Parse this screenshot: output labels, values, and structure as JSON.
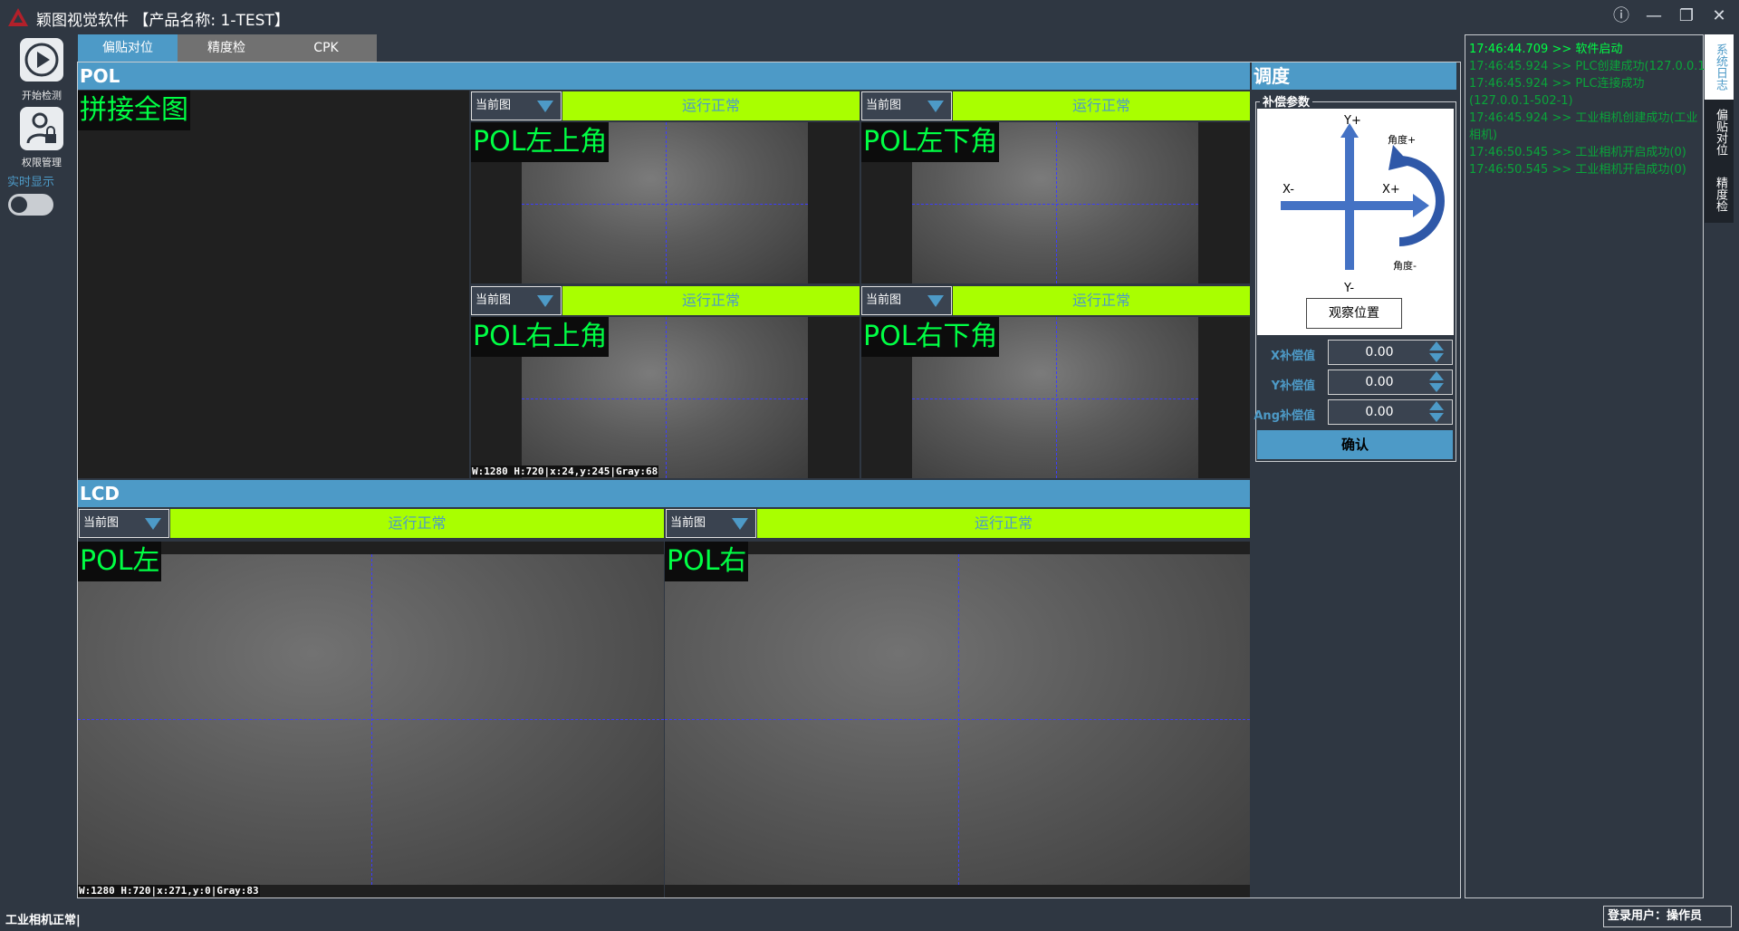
{
  "app": {
    "title": "颖图视觉软件",
    "product": "【产品名称: 1-TEST】"
  },
  "window_controls": [
    "info-icon",
    "minimize-icon",
    "restore-icon",
    "close-icon"
  ],
  "sidebar": {
    "start_label": "开始检测",
    "perm_label": "权限管理",
    "realtime_label": "实时显示",
    "realtime_on": false
  },
  "tabs": [
    {
      "label": "偏贴对位",
      "active": true
    },
    {
      "label": "精度检",
      "active": false
    },
    {
      "label": "CPK",
      "active": false
    }
  ],
  "pol": {
    "header": "POL",
    "stitch_label": "拼接全图",
    "cams": [
      {
        "label": "POL左上角",
        "select": "当前图",
        "status": "运行正常"
      },
      {
        "label": "POL左下角",
        "select": "当前图",
        "status": "运行正常"
      },
      {
        "label": "POL右上角",
        "select": "当前图",
        "status": "运行正常",
        "info": "W:1280 H:720|x:24,y:245|Gray:68"
      },
      {
        "label": "POL右下角",
        "select": "当前图",
        "status": "运行正常"
      }
    ]
  },
  "lcd": {
    "header": "LCD",
    "cams": [
      {
        "label": "POL左",
        "select": "当前图",
        "status": "运行正常",
        "info": "W:1280 H:720|x:271,y:0|Gray:83"
      },
      {
        "label": "POL右",
        "select": "当前图",
        "status": "运行正常"
      }
    ]
  },
  "adjust": {
    "header": "调度",
    "group": "补偿参数",
    "diagram": {
      "yplus": "Y+",
      "yminus": "Y-",
      "xminus": "X-",
      "xplus": "X+",
      "angplus": "角度+",
      "angminus": "角度-"
    },
    "observe_button": "观察位置",
    "fields": [
      {
        "label": "X补偿值",
        "value": "0.00"
      },
      {
        "label": "Y补偿值",
        "value": "0.00"
      },
      {
        "label": "Ang补偿值",
        "value": "0.00"
      }
    ],
    "confirm": "确认"
  },
  "log": {
    "lines": [
      {
        "text": "17:46:44.709 >> 软件启动",
        "dim": false
      },
      {
        "text": "17:46:45.924 >>  PLC创建成功(127.0.0.1)",
        "dim": true
      },
      {
        "text": "17:46:45.924 >>  PLC连接成功",
        "dim": true
      },
      {
        "text": "(127.0.0.1-502-1)",
        "dim": true
      },
      {
        "text": "17:46:45.924 >>  工业相机创建成功(工业",
        "dim": true
      },
      {
        "text": "相机)",
        "dim": true
      },
      {
        "text": "17:46:50.545 >>  工业相机开启成功(0)",
        "dim": true
      },
      {
        "text": "17:46:50.545 >>  工业相机开启成功(0)",
        "dim": true
      }
    ]
  },
  "right_tabs": [
    "系统日志",
    "偏贴对位",
    "精度检"
  ],
  "statusbar": {
    "left": "工业相机正常|",
    "user": "登录用户：操作员"
  }
}
